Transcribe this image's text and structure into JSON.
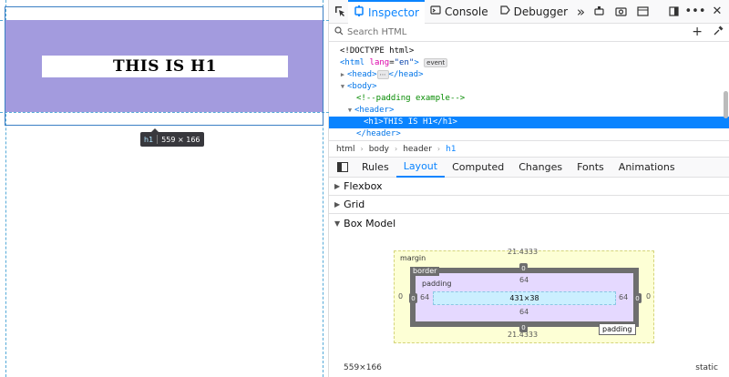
{
  "page": {
    "h1_text": "THIS IS H1",
    "tooltip_tag": "h1",
    "tooltip_size": "559 × 166"
  },
  "toolbar": {
    "tabs": [
      {
        "label": "Inspector",
        "icon": "inspector-icon"
      },
      {
        "label": "Console",
        "icon": "console-icon"
      },
      {
        "label": "Debugger",
        "icon": "debugger-icon"
      }
    ],
    "more": "»",
    "right_icons": [
      "responsive-icon",
      "screenshot-icon",
      "settings-icon",
      "dock-icon",
      "meatball-icon",
      "close-icon"
    ]
  },
  "search": {
    "placeholder": "Search HTML"
  },
  "markup": {
    "doctype": "<!DOCTYPE html>",
    "html_open_tag": "html",
    "html_attr": "lang",
    "html_val": "\"en\"",
    "event_badge": "event",
    "head": "head",
    "ellipsis": "⋯",
    "body": "body",
    "comment": "<!--padding example-->",
    "header": "header",
    "selected_h1": "<h1>THIS IS H1</h1>",
    "header_close": "</header>"
  },
  "breadcrumbs": [
    "html",
    "body",
    "header",
    "h1"
  ],
  "side_tabs": [
    "Rules",
    "Layout",
    "Computed",
    "Changes",
    "Fonts",
    "Animations"
  ],
  "side_active": "Layout",
  "accordions": [
    "Flexbox",
    "Grid",
    "Box Model"
  ],
  "box_model": {
    "margin_label": "margin",
    "border_label": "border",
    "padding_label": "padding",
    "margin_top": "21.4333",
    "margin_bottom": "21.4333",
    "margin_left": "0",
    "margin_right": "0",
    "border_top": "0",
    "border_bottom": "0",
    "border_left": "0",
    "border_right": "0",
    "padding_top": "64",
    "padding_bottom": "64",
    "padding_left": "64",
    "padding_right": "64",
    "content": "431×38",
    "tooltip": "padding"
  },
  "footer": {
    "size": "559×166",
    "position": "static"
  }
}
